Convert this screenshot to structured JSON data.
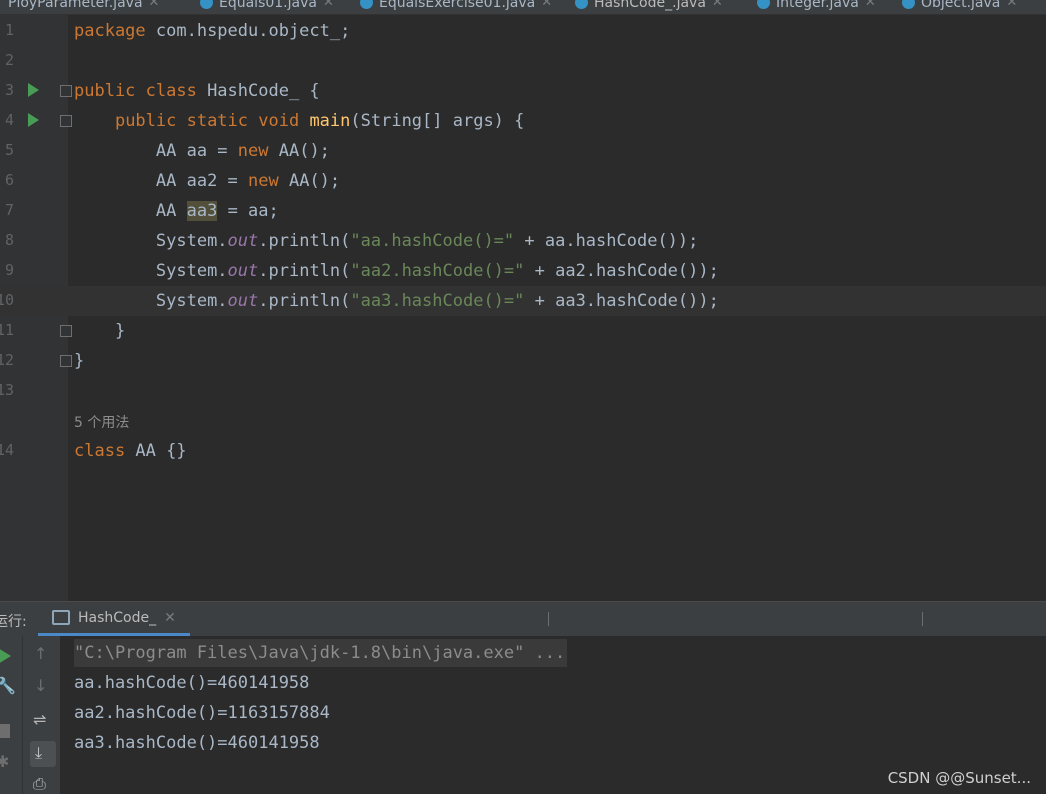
{
  "tabs": [
    {
      "label": "PloyParameter.java",
      "active": false
    },
    {
      "label": "Equals01.java",
      "active": false
    },
    {
      "label": "EqualsExercise01.java",
      "active": false
    },
    {
      "label": "HashCode_.java",
      "active": true
    },
    {
      "label": "Integer.java",
      "active": false
    },
    {
      "label": "Object.java",
      "active": false
    }
  ],
  "editor": {
    "line_numbers": [
      "1",
      "2",
      "3",
      "4",
      "5",
      "6",
      "7",
      "8",
      "9",
      "10",
      "11",
      "12",
      "13",
      "14"
    ],
    "code": {
      "l1_kw": "package",
      "l1_rest": " com.hspedu.object_;",
      "l3_kw": "public class",
      "l3_rest": " HashCode_ {",
      "l4_kw": "public static void",
      "l4_fn": "main",
      "l4_rest": "(String[] args) {",
      "l5_a": "AA aa = ",
      "l5_kw": "new",
      "l5_b": " AA();",
      "l6_a": "AA aa2 = ",
      "l6_kw": "new",
      "l6_b": " AA();",
      "l7_a": "AA ",
      "l7_var": "aa3",
      "l7_b": " = aa;",
      "l8_a": "System.",
      "l8_fld": "out",
      "l8_b": ".println(",
      "l8_str": "\"aa.hashCode()=\"",
      "l8_c": " + aa.hashCode());",
      "l9_a": "System.",
      "l9_fld": "out",
      "l9_b": ".println(",
      "l9_str": "\"aa2.hashCode()=\"",
      "l9_c": " + aa2.hashCode());",
      "l10_a": "System.",
      "l10_fld": "out",
      "l10_b": ".println(",
      "l10_str": "\"aa3.hashCode()=\"",
      "l10_c": " + aa3.hashCode());",
      "l11": "}",
      "l12": "}",
      "usage_hint": "5 个用法",
      "l14_kw": "class",
      "l14_rest": " AA {}"
    }
  },
  "run_panel": {
    "label": "运行:",
    "tab_label": "HashCode_",
    "command": "\"C:\\Program Files\\Java\\jdk-1.8\\bin\\java.exe\" ...",
    "output": [
      "aa.hashCode()=460141958",
      "aa2.hashCode()=1163157884",
      "aa3.hashCode()=460141958"
    ]
  },
  "watermark": "CSDN @@Sunset..."
}
